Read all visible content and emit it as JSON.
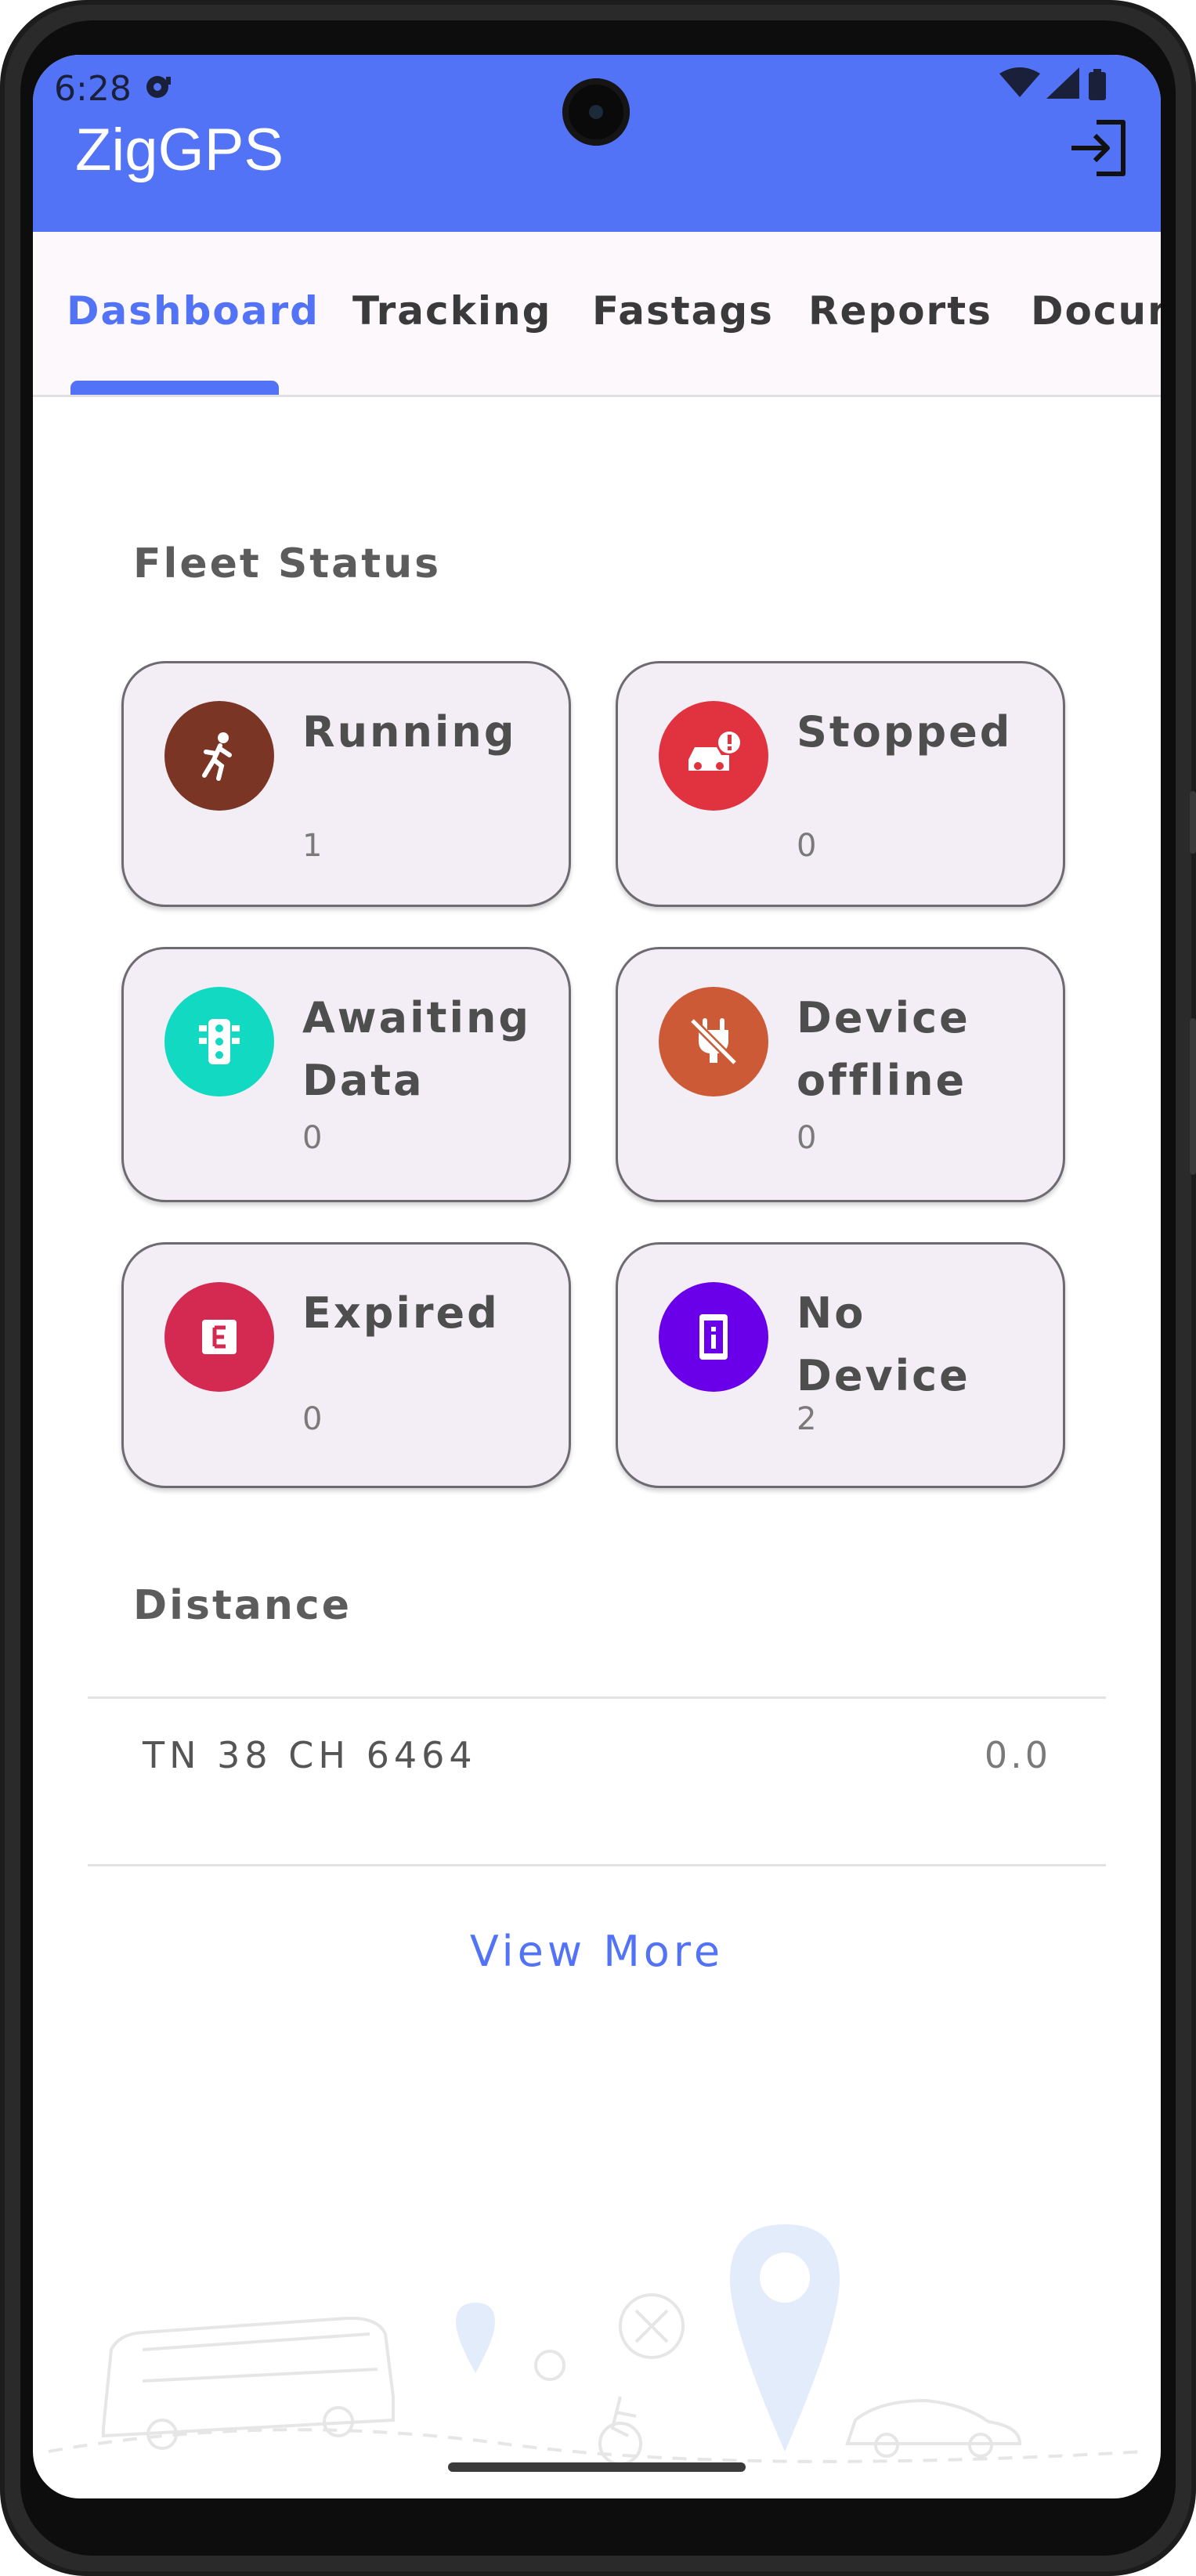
{
  "status_bar": {
    "time": "6:28"
  },
  "app": {
    "title": "ZigGPS"
  },
  "tabs": [
    {
      "label": "Dashboard",
      "active": true
    },
    {
      "label": "Tracking",
      "active": false
    },
    {
      "label": "Fastags",
      "active": false
    },
    {
      "label": "Reports",
      "active": false
    },
    {
      "label": "Docum",
      "active": false
    }
  ],
  "fleet_status": {
    "title": "Fleet Status",
    "cards": [
      {
        "label": "Running",
        "count": "1",
        "icon": "running-person-icon",
        "color": "#7a3524"
      },
      {
        "label": "Stopped",
        "count": "0",
        "icon": "car-alert-icon",
        "color": "#e1333f"
      },
      {
        "label": "Awaiting Data",
        "count": "0",
        "icon": "traffic-light-icon",
        "color": "#12d9c1"
      },
      {
        "label": "Device offline",
        "count": "0",
        "icon": "plug-off-icon",
        "color": "#cc5a36"
      },
      {
        "label": "Expired",
        "count": "0",
        "icon": "expired-badge-icon",
        "color": "#d42a51"
      },
      {
        "label": "No Device",
        "count": "2",
        "icon": "device-info-icon",
        "color": "#6a00ea"
      }
    ]
  },
  "distance": {
    "title": "Distance",
    "rows": [
      {
        "vehicle": "TN 38 CH 6464",
        "value": "0.0"
      }
    ],
    "view_more": "View More"
  },
  "colors": {
    "primary": "#5273f6",
    "card_bg": "#f3eef5",
    "tab_bg": "#fdf8fc"
  }
}
